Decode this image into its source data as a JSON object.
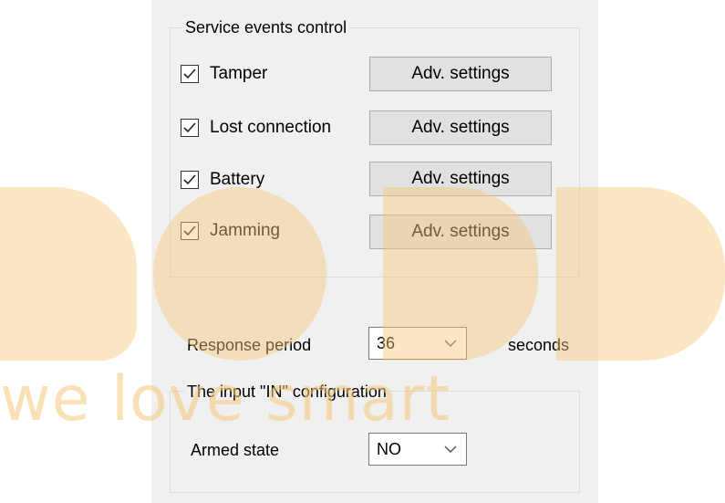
{
  "service_events": {
    "title": "Service events control",
    "items": [
      {
        "label": "Tamper",
        "checked": true,
        "button": "Adv. settings"
      },
      {
        "label": "Lost connection",
        "checked": true,
        "button": "Adv. settings"
      },
      {
        "label": "Battery",
        "checked": true,
        "button": "Adv. settings"
      },
      {
        "label": "Jamming",
        "checked": true,
        "button": "Adv. settings"
      }
    ]
  },
  "response_period": {
    "label": "Response period",
    "value": "36",
    "unit": "seconds"
  },
  "input_config": {
    "title": "The input \"IN\" configuration",
    "armed_state_label": "Armed state",
    "armed_state_value": "NO"
  },
  "icons": {
    "checkmark": "checkmark-icon",
    "dropdown": "chevron-down-icon"
  },
  "watermark": {
    "text": "we love smart",
    "color": "#f7c87a"
  }
}
